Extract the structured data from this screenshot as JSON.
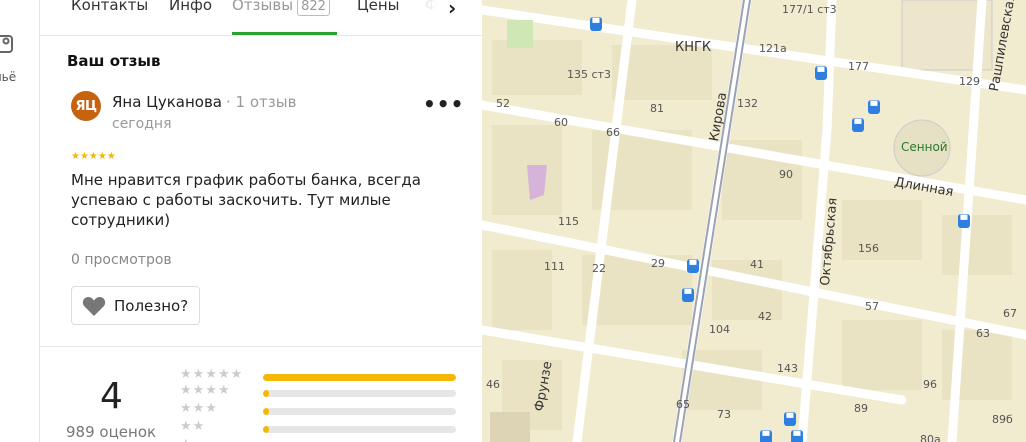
{
  "rail": {
    "label": "льё",
    "icon": "gallery-icon"
  },
  "tabs": [
    {
      "label": "Контакты"
    },
    {
      "label": "Инфо"
    },
    {
      "label": "Отзывы",
      "badge": "822",
      "active": true
    },
    {
      "label": "Цены"
    },
    {
      "label": "Фо"
    }
  ],
  "section_title": "Ваш отзыв",
  "review": {
    "avatar_initials": "ЯЦ",
    "author": "Яна Цуканова",
    "author_reviews": "· 1 отзыв",
    "date": "сегодня",
    "stars": "★★★★★",
    "text": "Мне нравится график работы банка, всегда успеваю с работы заскочить. Тут милые сотрудники)",
    "views": "0 просмотров",
    "helpful_label": "Полезно?",
    "more": "•••"
  },
  "summary": {
    "rating": "4",
    "count": "989 оценок",
    "distribution": [
      {
        "stars": "★★★★★",
        "fraction": 1.0
      },
      {
        "stars": "★★★★",
        "fraction": 0.03
      },
      {
        "stars": "★★★",
        "fraction": 0.03
      },
      {
        "stars": "★★",
        "fraction": 0.03
      },
      {
        "stars": "★",
        "fraction": 0.03
      }
    ]
  },
  "colors": {
    "accent_green": "#2ca02c",
    "star_gold": "#f5b800",
    "avatar": "#c7620f",
    "bus_stop": "#2e7fe0",
    "map_bg": "#f1ebd0"
  },
  "map": {
    "streets": [
      "КНГК",
      "Кирова",
      "Октябрьская",
      "Длинная",
      "Фрунзе",
      "Рашпилевская"
    ],
    "place": "Сенной",
    "numbers": [
      "177/1 ст3",
      "121а",
      "177",
      "129",
      "135 ст3",
      "81",
      "132",
      "52",
      "60",
      "66",
      "90",
      "115",
      "156",
      "111",
      "22",
      "29",
      "41",
      "104",
      "42",
      "57",
      "63",
      "67",
      "46",
      "65",
      "73",
      "143",
      "89",
      "96",
      "80а",
      "89б"
    ]
  }
}
